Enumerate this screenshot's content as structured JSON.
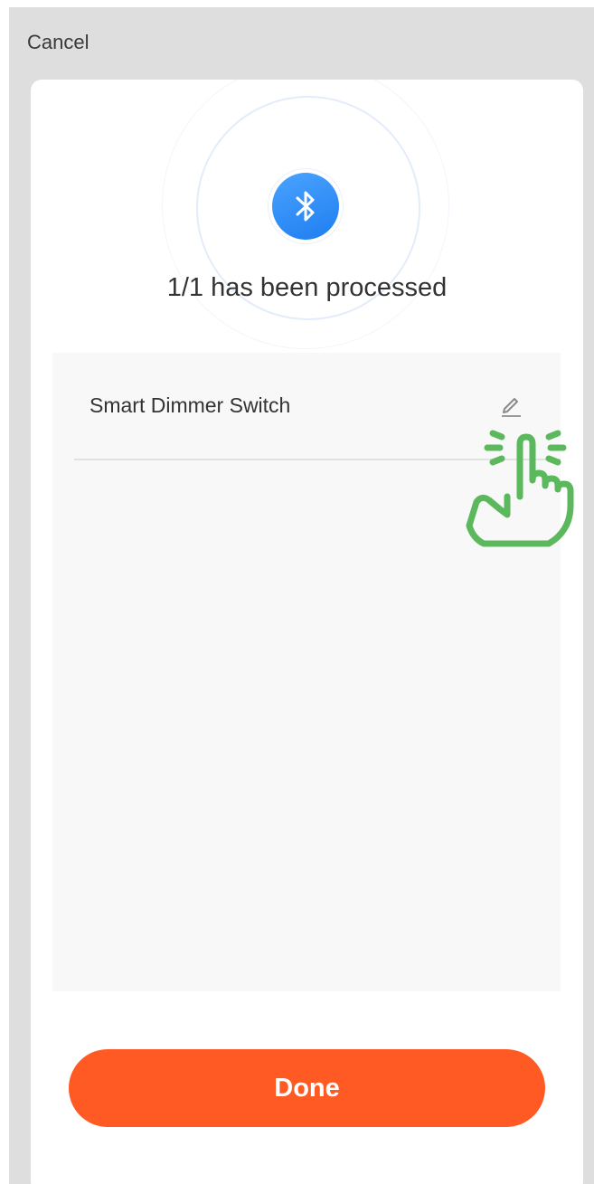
{
  "header": {
    "cancel_label": "Cancel"
  },
  "status": {
    "message": "1/1 has been processed",
    "icon": "bluetooth-icon"
  },
  "devices": [
    {
      "name": "Smart Dimmer Switch",
      "action_icon": "edit-pencil-icon"
    }
  ],
  "footer": {
    "done_label": "Done"
  },
  "colors": {
    "accent": "#ff5a24",
    "bluetooth": "#2b8cf5",
    "hint_hand": "#5cb85c"
  }
}
